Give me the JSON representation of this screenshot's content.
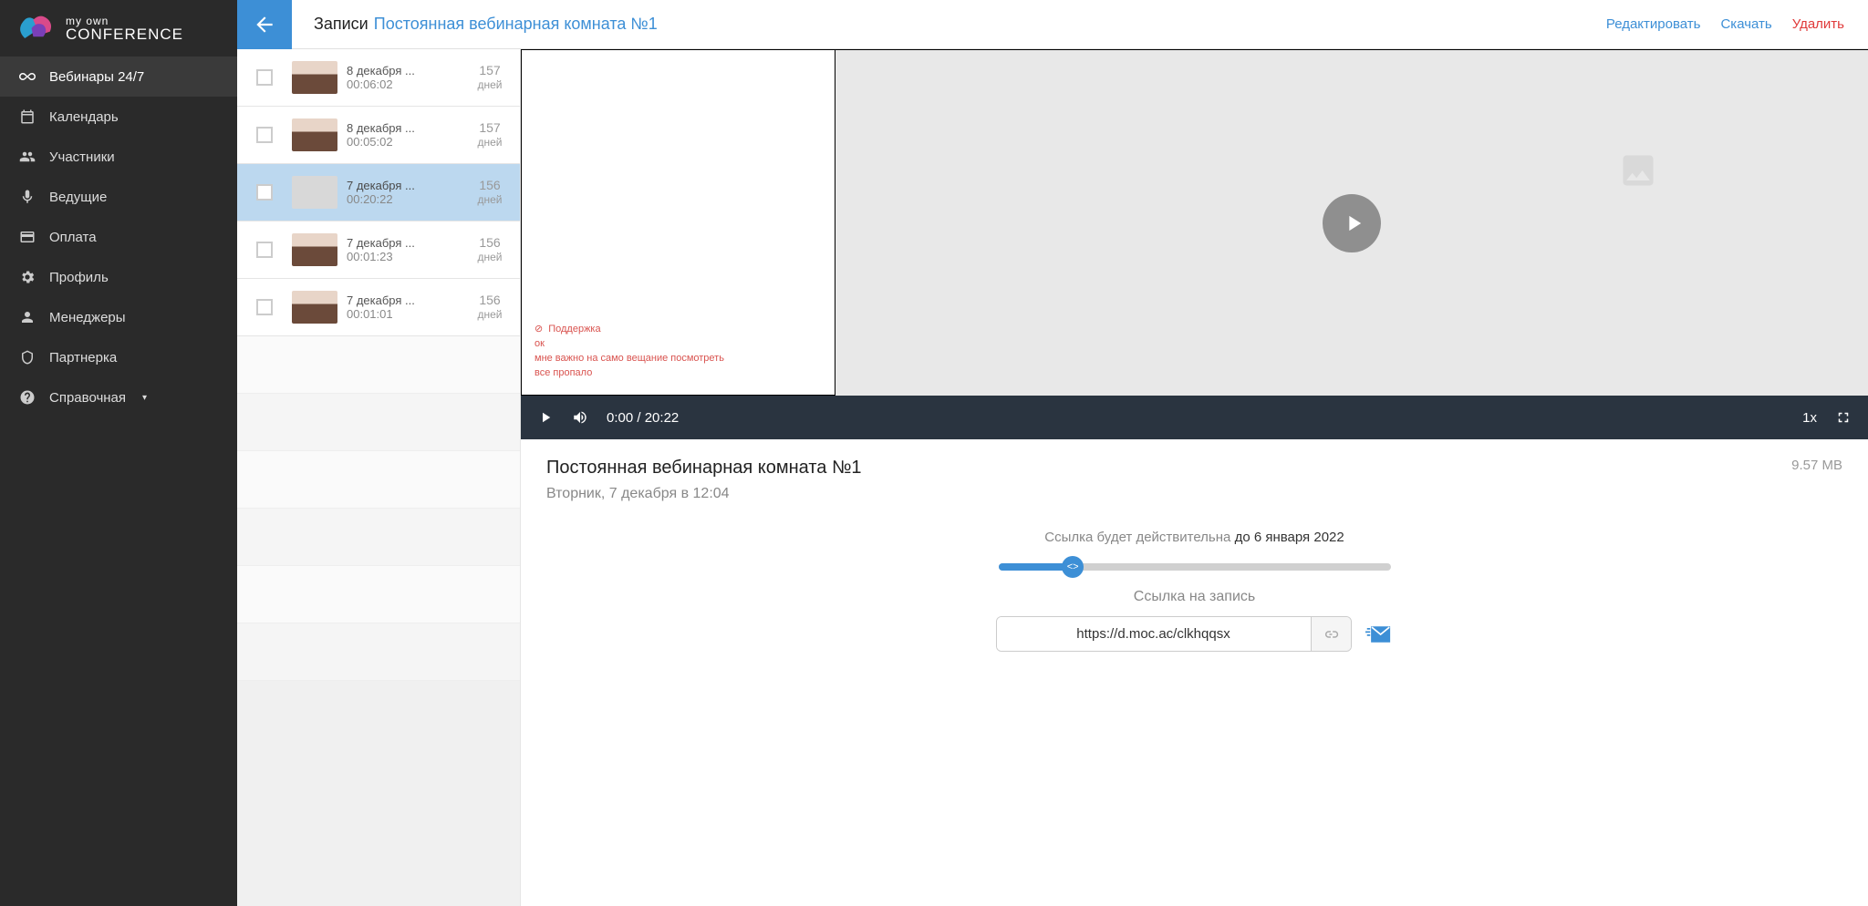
{
  "brand": {
    "line1": "my own",
    "line2": "CONFERENCE"
  },
  "sidebar": {
    "items": [
      {
        "label": "Вебинары 24/7",
        "icon": "infinity",
        "active": true
      },
      {
        "label": "Календарь",
        "icon": "calendar"
      },
      {
        "label": "Участники",
        "icon": "users"
      },
      {
        "label": "Ведущие",
        "icon": "mic"
      },
      {
        "label": "Оплата",
        "icon": "card"
      },
      {
        "label": "Профиль",
        "icon": "gear"
      },
      {
        "label": "Менеджеры",
        "icon": "managers"
      },
      {
        "label": "Партнерка",
        "icon": "affiliate"
      },
      {
        "label": "Справочная",
        "icon": "help",
        "caret": true
      }
    ]
  },
  "header": {
    "crumb_root": "Записи",
    "crumb_room": "Постоянная вебинарная комната №1",
    "actions": {
      "edit": "Редактировать",
      "download": "Скачать",
      "delete": "Удалить"
    }
  },
  "recordings": [
    {
      "date": "8 декабря ...",
      "duration": "00:06:02",
      "age_n": "157",
      "age_u": "дней",
      "thumb": "person"
    },
    {
      "date": "8 декабря ...",
      "duration": "00:05:02",
      "age_n": "157",
      "age_u": "дней",
      "thumb": "person"
    },
    {
      "date": "7 декабря ...",
      "duration": "00:20:22",
      "age_n": "156",
      "age_u": "дней",
      "thumb": "blank",
      "selected": true
    },
    {
      "date": "7 декабря ...",
      "duration": "00:01:23",
      "age_n": "156",
      "age_u": "дней",
      "thumb": "person"
    },
    {
      "date": "7 декабря ...",
      "duration": "00:01:01",
      "age_n": "156",
      "age_u": "дней",
      "thumb": "person"
    }
  ],
  "player": {
    "current": "0:00",
    "sep": " / ",
    "total": "20:22",
    "speed": "1x",
    "chat": [
      {
        "icon": true,
        "text": "Поддержка"
      },
      {
        "text": "ок"
      },
      {
        "text": "мне важно на само вещание посмотреть"
      },
      {
        "text": "все пропало"
      }
    ]
  },
  "meta": {
    "title": "Постоянная вебинарная комната №1",
    "size": "9.57 MB",
    "when": "Вторник, 7 декабря в 12:04",
    "link_valid_prefix": "Ссылка будет действительна",
    "link_valid_until": "до 6 января 2022",
    "link_label": "Ссылка на запись",
    "link_url": "https://d.moc.ac/clkhqqsx",
    "slider_percent": 19
  }
}
